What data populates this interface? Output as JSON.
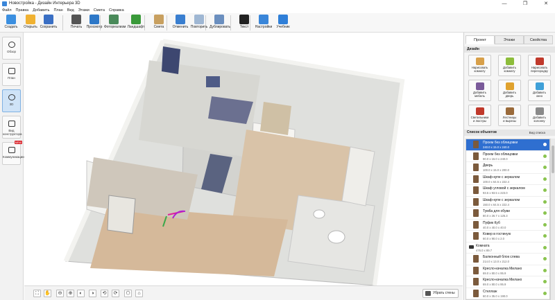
{
  "window": {
    "title": "Новостройка - Дизайн Интерьера 3D",
    "controls": [
      "—",
      "❐",
      "✕"
    ]
  },
  "menu": [
    "Файл",
    "Правка",
    "Добавить",
    "План",
    "Вид",
    "Этажи",
    "Смета",
    "Справка"
  ],
  "toolbar": [
    {
      "label": "Создать",
      "icon": "new-file-icon",
      "color": "#3b8fe0"
    },
    {
      "label": "Открыть",
      "icon": "open-folder-icon",
      "color": "#f0b232"
    },
    {
      "label": "Сохранить",
      "icon": "save-icon",
      "color": "#3a6fc4"
    },
    {
      "label": "Печать",
      "icon": "print-icon",
      "color": "#555555"
    },
    {
      "label": "Просмотр",
      "icon": "monitor-icon",
      "color": "#2d78c8"
    },
    {
      "label": "Фотореализм",
      "icon": "photo-icon",
      "color": "#4a8a5a"
    },
    {
      "label": "Ландшафт",
      "icon": "landscape-icon",
      "color": "#3a9a3a"
    },
    {
      "label": "Смета",
      "icon": "estimate-icon",
      "color": "#c8a060"
    },
    {
      "label": "Отменить",
      "icon": "undo-icon",
      "color": "#3a7fd0"
    },
    {
      "label": "Повторить",
      "icon": "redo-icon",
      "color": "#9fb7d3"
    },
    {
      "label": "Дублировать",
      "icon": "duplicate-icon",
      "color": "#6b8fbf"
    },
    {
      "label": "Текст",
      "icon": "text-icon",
      "color": "#222222"
    },
    {
      "label": "Настройки",
      "icon": "settings-gear-icon",
      "color": "#3a86d9"
    },
    {
      "label": "Учебник",
      "icon": "help-icon",
      "color": "#2f7fd8"
    }
  ],
  "leftnav": [
    {
      "label": "Обзор",
      "icon": "eye-icon",
      "active": false
    },
    {
      "label": "План",
      "icon": "plan-icon",
      "active": false
    },
    {
      "label": "3D",
      "icon": "cube-3d-icon",
      "active": true
    },
    {
      "label": "Вид\nконструктора",
      "icon": "constructor-view-icon",
      "active": false
    },
    {
      "label": "Коммуникации",
      "icon": "communications-icon",
      "active": false,
      "badge": "NEW"
    }
  ],
  "right": {
    "tabs": [
      "Проект",
      "Этажи",
      "Свойства"
    ],
    "active_tab": "Проект",
    "design_title": "Дизайн",
    "design_buttons": [
      {
        "label": "Нарисовать\nкомнату",
        "icon": "draw-room-icon",
        "color": "#d8a04a"
      },
      {
        "label": "Добавить\nкомнату",
        "icon": "add-room-icon",
        "color": "#8dbd3b"
      },
      {
        "label": "Нарисовать\nперегородку",
        "icon": "draw-partition-icon",
        "color": "#c0392b"
      },
      {
        "label": "Добавить\nмебель",
        "icon": "add-furniture-icon",
        "color": "#7a5a9a"
      },
      {
        "label": "Добавить\nдверь",
        "icon": "add-door-icon",
        "color": "#e0a22e"
      },
      {
        "label": "Добавить\nокно",
        "icon": "add-window-icon",
        "color": "#3fa0d8"
      },
      {
        "label": "Светильники\nи люстры",
        "icon": "lamp-icon",
        "color": "#c0392b"
      },
      {
        "label": "Лестницы\nи вырезы",
        "icon": "stairs-icon",
        "color": "#9a6a3a"
      },
      {
        "label": "Добавить\nколонну",
        "icon": "add-column-icon",
        "color": "#8a8a8a"
      }
    ],
    "objects_title": "Список объектов",
    "view_list": "Вид списка",
    "objects": [
      {
        "name": "Проем без облицовки",
        "dim": "240.0 x 15.0 x 240.0",
        "selected": true,
        "group": false
      },
      {
        "name": "Проем без облицовки",
        "dim": "90.0 x 15.0 x 240.0",
        "selected": false,
        "group": false
      },
      {
        "name": "Дверь",
        "dim": "100.0 x 15.0 x 200.0",
        "selected": false,
        "group": false
      },
      {
        "name": "Шкаф-купе с зеркалом",
        "dim": "100.0 x 64.5 x 222.4",
        "selected": false,
        "group": false
      },
      {
        "name": "Шкаф угловой с зеркалом",
        "dim": "93.5 x 93.5 x 223.0",
        "selected": false,
        "group": false
      },
      {
        "name": "Шкаф-купе с зеркалом",
        "dim": "150.0 x 64.5 x 222.4",
        "selected": false,
        "group": false
      },
      {
        "name": "Тумба для обуви",
        "dim": "80.0 x 26.7 x 125.3",
        "selected": false,
        "group": false
      },
      {
        "name": "Пуфик Куб",
        "dim": "40.0 x 40.0 x 40.0",
        "selected": false,
        "group": false
      },
      {
        "name": "Ковер в гостиную",
        "dim": "60.0 x 90.0 x 2.0",
        "selected": false,
        "group": false
      },
      {
        "name": "Комната",
        "dim": "476.0 x 89.7",
        "selected": false,
        "group": true
      },
      {
        "name": "Балконный блок слева",
        "dim": "214.0 x 13.0 x 212.0",
        "selected": false,
        "group": false
      },
      {
        "name": "Кресло-качалка Милано",
        "dim": "69.0 x 80.0 x 95.9",
        "selected": false,
        "group": false
      },
      {
        "name": "Кресло-качалка Милано",
        "dim": "69.0 x 80.0 x 95.9",
        "selected": false,
        "group": false
      },
      {
        "name": "Стеллаж",
        "dim": "60.0 x 35.0 x 190.0",
        "selected": false,
        "group": false
      }
    ]
  },
  "bottom": {
    "tools": [
      "⛶",
      "✋",
      "⊖",
      "⊕",
      "◐",
      "◑",
      "⟲",
      "⟳",
      "⬡",
      "⌂"
    ],
    "walls_button": "Убрать стены"
  }
}
